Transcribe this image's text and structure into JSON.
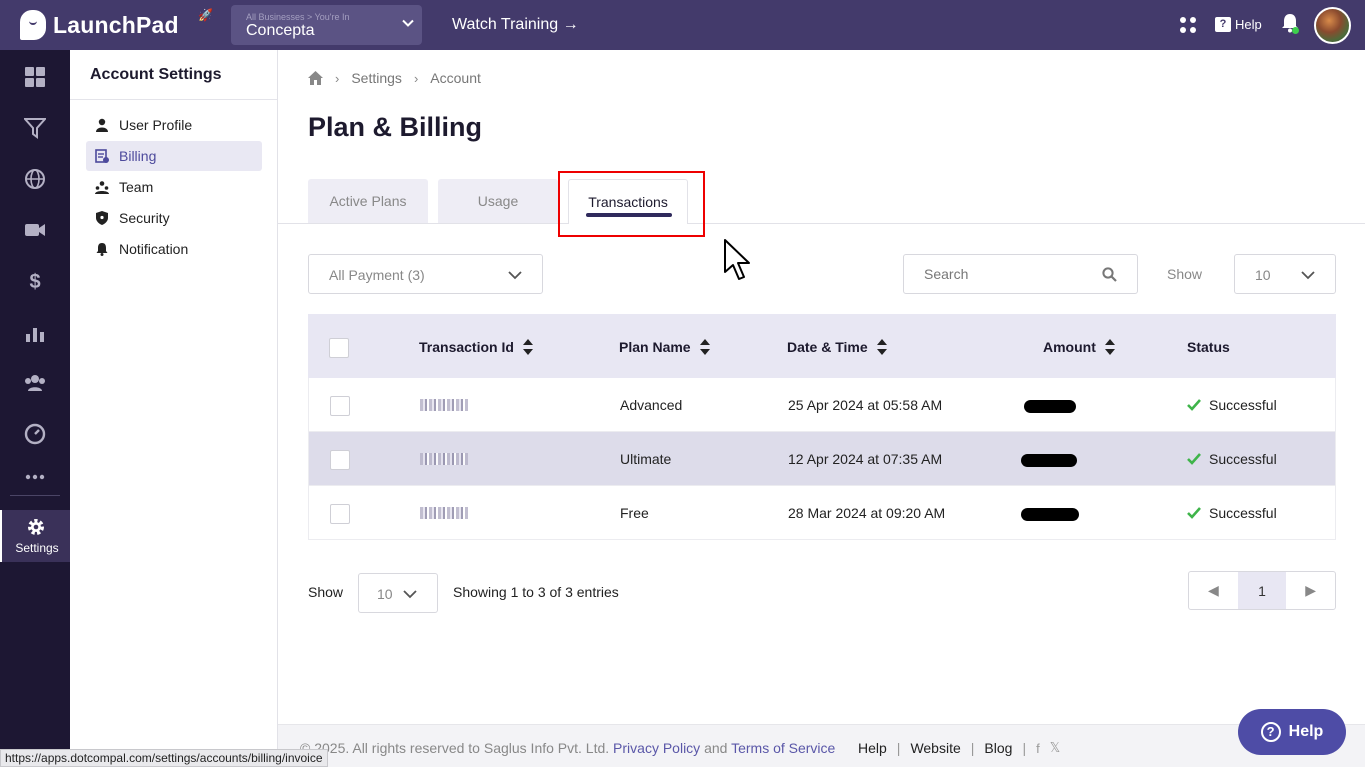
{
  "app": {
    "name": "LaunchPad"
  },
  "topbar": {
    "business_crumb": "All Businesses > You're In",
    "business_name": "Concepta",
    "watch_training": "Watch Training →",
    "help_label": "Help",
    "help_q": "?"
  },
  "leftnav": {
    "items": [
      "dashboard-icon",
      "funnel-icon",
      "globe-icon",
      "video-icon",
      "dollar-icon",
      "analytics-icon",
      "users-icon",
      "speed-icon",
      "more-icon"
    ],
    "settings_label": "Settings"
  },
  "account_settings": {
    "title": "Account Settings",
    "items": [
      {
        "label": "User Profile",
        "icon": "user-icon"
      },
      {
        "label": "Billing",
        "icon": "billing-icon",
        "active": true
      },
      {
        "label": "Team",
        "icon": "team-icon"
      },
      {
        "label": "Security",
        "icon": "shield-icon"
      },
      {
        "label": "Notification",
        "icon": "bell-icon"
      }
    ]
  },
  "breadcrumb": {
    "items": [
      "Settings",
      "Account"
    ]
  },
  "page_title": "Plan & Billing",
  "tabs": [
    {
      "label": "Active Plans"
    },
    {
      "label": "Usage"
    },
    {
      "label": "Transactions",
      "active": true
    }
  ],
  "filters": {
    "payment_select": "All Payment (3)",
    "search_placeholder": "Search",
    "show_label": "Show",
    "show_value": "10"
  },
  "table": {
    "columns": [
      "Transaction Id",
      "Plan Name",
      "Date & Time",
      "Amount",
      "Status"
    ],
    "rows": [
      {
        "plan": "Advanced",
        "datetime": "25 Apr 2024 at 05:58 AM",
        "status": "Successful"
      },
      {
        "plan": "Ultimate",
        "datetime": "12 Apr 2024 at 07:35 AM",
        "status": "Successful"
      },
      {
        "plan": "Free",
        "datetime": "28 Mar 2024 at 09:20 AM",
        "status": "Successful"
      }
    ]
  },
  "pagination": {
    "show_label": "Show",
    "show_value": "10",
    "entries_text": "Showing 1 to 3 of 3 entries",
    "prev": "◀",
    "current": "1",
    "next": "▶"
  },
  "footer": {
    "copyright": "©  2025. All rights reserved to Saglus Info Pvt. Ltd.",
    "privacy": "Privacy Policy",
    "and": "and",
    "terms": "Terms of Service",
    "links": [
      "Help",
      "Website",
      "Blog"
    ],
    "social": [
      "f",
      "𝕏"
    ]
  },
  "help_button": {
    "label": "Help",
    "q": "?"
  },
  "status_url": "https://apps.dotcompal.com/settings/accounts/billing/invoice",
  "colors": {
    "brand": "#433a6b",
    "nav": "#1d1733",
    "accent": "#4e4ca6",
    "success": "#3fb44a",
    "highlight": "#e00000"
  }
}
